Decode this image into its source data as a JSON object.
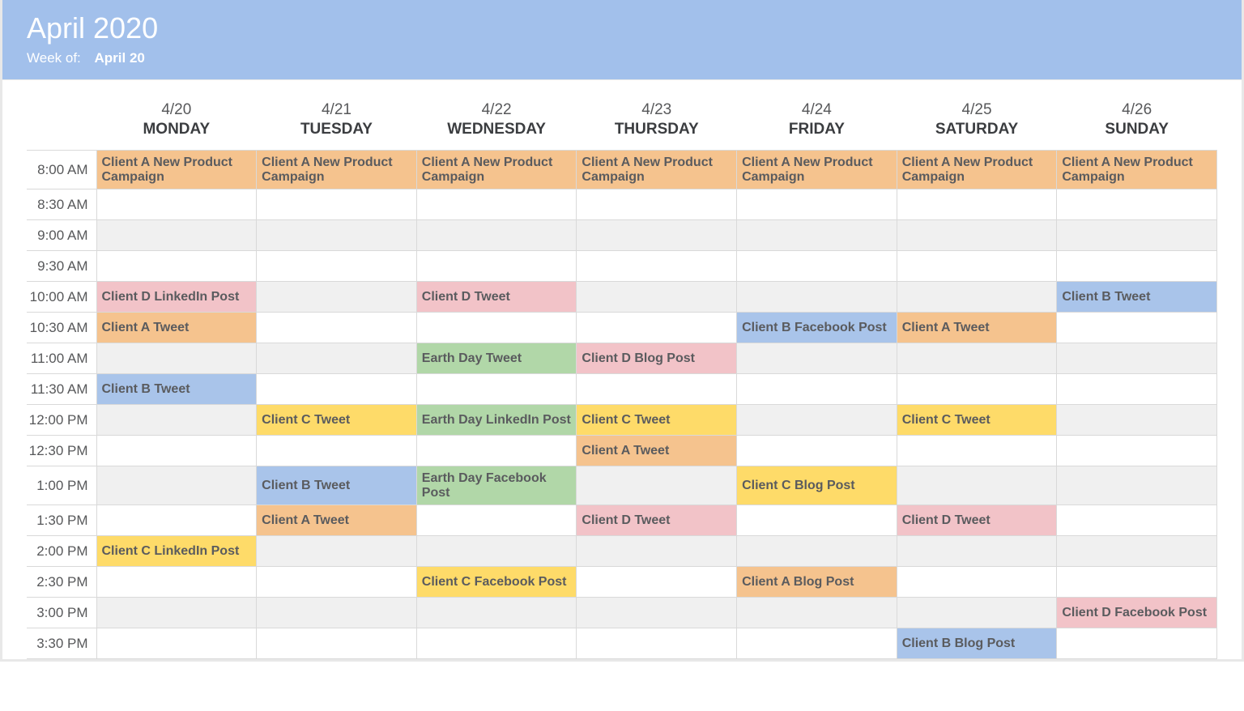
{
  "header": {
    "title": "April 2020",
    "week_of_label": "Week of:",
    "week_of_value": "April 20"
  },
  "days": [
    {
      "date": "4/20",
      "name": "MONDAY"
    },
    {
      "date": "4/21",
      "name": "TUESDAY"
    },
    {
      "date": "4/22",
      "name": "WEDNESDAY"
    },
    {
      "date": "4/23",
      "name": "THURSDAY"
    },
    {
      "date": "4/24",
      "name": "FRIDAY"
    },
    {
      "date": "4/25",
      "name": "SATURDAY"
    },
    {
      "date": "4/26",
      "name": "SUNDAY"
    }
  ],
  "times": [
    "8:00 AM",
    "8:30 AM",
    "9:00 AM",
    "9:30 AM",
    "10:00 AM",
    "10:30 AM",
    "11:00 AM",
    "11:30 AM",
    "12:00 PM",
    "12:30 PM",
    "1:00 PM",
    "1:30 PM",
    "2:00 PM",
    "2:30 PM",
    "3:00 PM",
    "3:30 PM"
  ],
  "colors": {
    "orange": "#f5c38e",
    "pink": "#f2c3c8",
    "blue": "#a9c4ea",
    "green": "#b1d7a8",
    "yellow": "#fedb69"
  },
  "events": [
    {
      "time": "8:00 AM",
      "day": 0,
      "text": "Client A New Product Campaign",
      "color": "orange"
    },
    {
      "time": "8:00 AM",
      "day": 1,
      "text": "Client A New Product Campaign",
      "color": "orange"
    },
    {
      "time": "8:00 AM",
      "day": 2,
      "text": "Client A New Product Campaign",
      "color": "orange"
    },
    {
      "time": "8:00 AM",
      "day": 3,
      "text": "Client A New Product Campaign",
      "color": "orange"
    },
    {
      "time": "8:00 AM",
      "day": 4,
      "text": "Client A New Product Campaign",
      "color": "orange"
    },
    {
      "time": "8:00 AM",
      "day": 5,
      "text": "Client A New Product Campaign",
      "color": "orange"
    },
    {
      "time": "8:00 AM",
      "day": 6,
      "text": "Client A New Product Campaign",
      "color": "orange"
    },
    {
      "time": "10:00 AM",
      "day": 0,
      "text": "Client D LinkedIn Post",
      "color": "pink"
    },
    {
      "time": "10:00 AM",
      "day": 2,
      "text": "Client D Tweet",
      "color": "pink"
    },
    {
      "time": "10:00 AM",
      "day": 6,
      "text": "Client B Tweet",
      "color": "blue"
    },
    {
      "time": "10:30 AM",
      "day": 0,
      "text": "Client A Tweet",
      "color": "orange"
    },
    {
      "time": "10:30 AM",
      "day": 4,
      "text": "Client B Facebook Post",
      "color": "blue"
    },
    {
      "time": "10:30 AM",
      "day": 5,
      "text": "Client A Tweet",
      "color": "orange"
    },
    {
      "time": "11:00 AM",
      "day": 2,
      "text": "Earth Day Tweet",
      "color": "green"
    },
    {
      "time": "11:00 AM",
      "day": 3,
      "text": "Client D Blog Post",
      "color": "pink"
    },
    {
      "time": "11:30 AM",
      "day": 0,
      "text": "Client B Tweet",
      "color": "blue"
    },
    {
      "time": "12:00 PM",
      "day": 1,
      "text": "Client C Tweet",
      "color": "yellow"
    },
    {
      "time": "12:00 PM",
      "day": 2,
      "text": "Earth Day LinkedIn Post",
      "color": "green"
    },
    {
      "time": "12:00 PM",
      "day": 3,
      "text": "Client C Tweet",
      "color": "yellow"
    },
    {
      "time": "12:00 PM",
      "day": 5,
      "text": "Client C Tweet",
      "color": "yellow"
    },
    {
      "time": "12:30 PM",
      "day": 3,
      "text": "Client A Tweet",
      "color": "orange"
    },
    {
      "time": "1:00 PM",
      "day": 1,
      "text": "Client B Tweet",
      "color": "blue"
    },
    {
      "time": "1:00 PM",
      "day": 2,
      "text": "Earth Day Facebook Post",
      "color": "green"
    },
    {
      "time": "1:00 PM",
      "day": 4,
      "text": "Client C Blog Post",
      "color": "yellow"
    },
    {
      "time": "1:30 PM",
      "day": 1,
      "text": "Client A Tweet",
      "color": "orange"
    },
    {
      "time": "1:30 PM",
      "day": 3,
      "text": "Client D Tweet",
      "color": "pink"
    },
    {
      "time": "1:30 PM",
      "day": 5,
      "text": "Client D Tweet",
      "color": "pink"
    },
    {
      "time": "2:00 PM",
      "day": 0,
      "text": "Client C LinkedIn Post",
      "color": "yellow"
    },
    {
      "time": "2:30 PM",
      "day": 2,
      "text": "Client C Facebook Post",
      "color": "yellow"
    },
    {
      "time": "2:30 PM",
      "day": 4,
      "text": "Client A Blog Post",
      "color": "orange"
    },
    {
      "time": "3:00 PM",
      "day": 6,
      "text": "Client D Facebook Post",
      "color": "pink"
    },
    {
      "time": "3:30 PM",
      "day": 5,
      "text": "Client B Blog Post",
      "color": "blue"
    }
  ]
}
